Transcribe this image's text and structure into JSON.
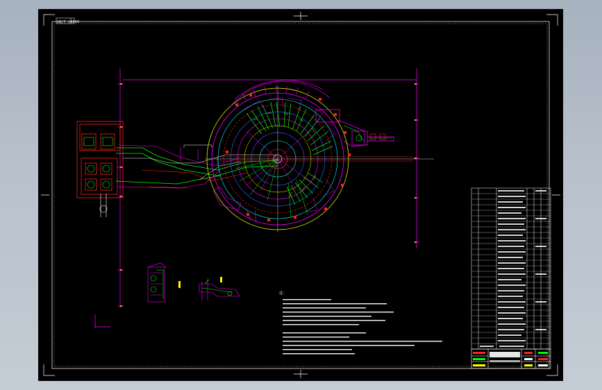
{
  "sheet": {
    "code_label": "GB/T 14689",
    "notes_heading": "注："
  },
  "colors": {
    "background": "#000000",
    "window_bg": "#b4bec9",
    "frame": "#ffffff",
    "magenta": "#ff00ff",
    "green": "#00ff00",
    "red": "#ff2020",
    "yellow": "#ffff00",
    "cyan": "#00ffff",
    "blue": "#3355ff",
    "orange": "#ffa000"
  },
  "icons": [
    "notes-text-block-icon",
    "bill-of-materials-icon",
    "title-block-icon"
  ]
}
